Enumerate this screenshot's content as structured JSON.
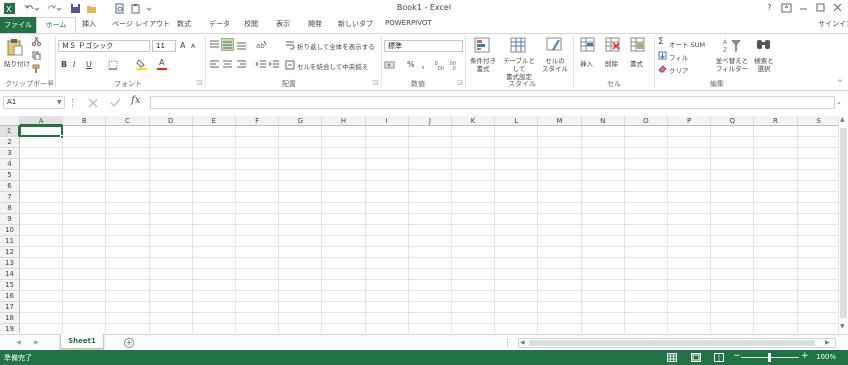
{
  "window": {
    "title": "Book1 - Excel",
    "help": "?",
    "signin": "サインイン"
  },
  "tabs": {
    "file": "ファイル",
    "home": "ホーム",
    "items": [
      "挿入",
      "ページ レイアウト",
      "数式",
      "データ",
      "校閲",
      "表示",
      "開発",
      "新しいタブ",
      "POWERPIVOT"
    ]
  },
  "ribbon": {
    "clipboard": {
      "paste": "貼り付け",
      "label": "クリップボード"
    },
    "font": {
      "name": "ＭＳ Ｐゴシック",
      "size": "11",
      "label": "フォント",
      "bold": "B",
      "italic": "I",
      "underline": "U",
      "font_color_glyph": "A",
      "grow": "A",
      "shrink": "A"
    },
    "alignment": {
      "wrap": "折り返して全体を表示する",
      "merge": "セルを結合して中央揃え",
      "label": "配置"
    },
    "number": {
      "format": "標準",
      "percent": "%",
      "comma": "，",
      "label": "数値"
    },
    "styles": {
      "conditional": "条件付き",
      "conditional2": "書式",
      "table": "テーブルとして",
      "table2": "書式設定",
      "cell": "セルの",
      "cell2": "スタイル",
      "label": "スタイル"
    },
    "cells": {
      "insert": "挿入",
      "delete": "削除",
      "format": "書式",
      "label": "セル"
    },
    "editing": {
      "autosum": "オート SUM",
      "fill": "フィル",
      "clear": "クリア",
      "sort": "並べ替えと",
      "sort2": "フィルター",
      "find": "検索と",
      "find2": "選択",
      "label": "編集"
    }
  },
  "formula_bar": {
    "name_box": "A1",
    "fx": "fx",
    "value": ""
  },
  "grid": {
    "columns": [
      "A",
      "B",
      "C",
      "D",
      "E",
      "F",
      "G",
      "H",
      "I",
      "J",
      "K",
      "L",
      "M",
      "N",
      "O",
      "P",
      "Q",
      "R",
      "S"
    ],
    "rows": [
      "1",
      "2",
      "3",
      "4",
      "5",
      "6",
      "7",
      "8",
      "9",
      "10",
      "11",
      "12",
      "13",
      "14",
      "15",
      "16",
      "17",
      "18",
      "19"
    ],
    "selected_cell": "A1"
  },
  "sheets": {
    "active": "Sheet1",
    "add": "+"
  },
  "status": {
    "ready": "準備完了",
    "zoom": "100%"
  },
  "colors": {
    "accent": "#217346"
  }
}
